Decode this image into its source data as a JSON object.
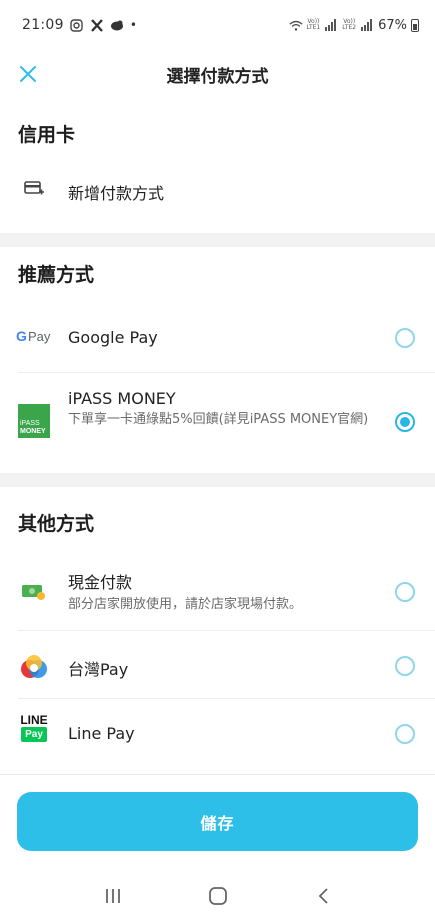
{
  "status_bar": {
    "time": "21:09",
    "dot": "•",
    "lte1": "LTE1",
    "lte2": "LTE2",
    "vol": "Vo))",
    "battery": "67%"
  },
  "header": {
    "title": "選擇付款方式"
  },
  "credit_card": {
    "section_title": "信用卡",
    "add_label": "新增付款方式"
  },
  "recommended": {
    "section_title": "推薦方式",
    "items": [
      {
        "label": "Google Pay",
        "description": "",
        "checked": false,
        "icon_text": "G Pay"
      },
      {
        "label": "iPASS MONEY",
        "description": "下單享一卡通綠點5%回饋(詳見iPASS MONEY官網)",
        "checked": true,
        "icon_text_top": "iPASS",
        "icon_text_bottom": "MONEY"
      }
    ]
  },
  "others": {
    "section_title": "其他方式",
    "items": [
      {
        "label": "現金付款",
        "description": "部分店家開放使用，請於店家現場付款。",
        "checked": false
      },
      {
        "label": "台灣Pay",
        "description": "",
        "checked": false
      },
      {
        "label": "Line Pay",
        "description": "",
        "checked": false,
        "icon_text_top": "LINE",
        "icon_text_bottom": "Pay"
      }
    ]
  },
  "save_label": "儲存",
  "colors": {
    "accent": "#2ebfe9",
    "radio_unchecked": "#8fd6ea",
    "ipass_green": "#3aa54a",
    "line_green": "#06c755"
  }
}
